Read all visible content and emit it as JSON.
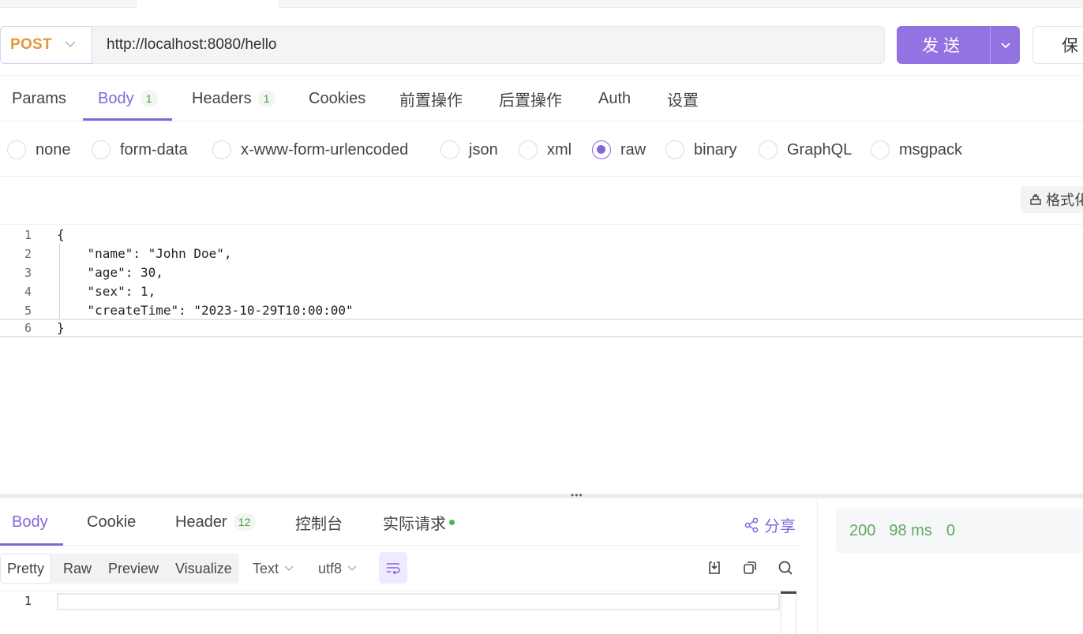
{
  "request": {
    "method": "POST",
    "url": "http://localhost:8080/hello",
    "send_label": "发送",
    "save_label": "保"
  },
  "request_tabs": [
    {
      "label": "Params",
      "badge": ""
    },
    {
      "label": "Body",
      "badge": "1"
    },
    {
      "label": "Headers",
      "badge": "1"
    },
    {
      "label": "Cookies",
      "badge": ""
    },
    {
      "label": "前置操作",
      "badge": ""
    },
    {
      "label": "后置操作",
      "badge": ""
    },
    {
      "label": "Auth",
      "badge": ""
    },
    {
      "label": "设置",
      "badge": ""
    }
  ],
  "body_types": [
    "none",
    "form-data",
    "x-www-form-urlencoded",
    "json",
    "xml",
    "raw",
    "binary",
    "GraphQL",
    "msgpack"
  ],
  "body_type_selected": "raw",
  "format_label": "格式化",
  "editor": {
    "line_numbers": [
      "1",
      "2",
      "3",
      "4",
      "5",
      "6"
    ],
    "lines": [
      "{",
      "    \"name\": \"John Doe\",",
      "    \"age\": 30,",
      "    \"sex\": 1,",
      "    \"createTime\": \"2023-10-29T10:00:00\"",
      "}"
    ]
  },
  "response_tabs": [
    {
      "label": "Body",
      "badge": ""
    },
    {
      "label": "Cookie",
      "badge": ""
    },
    {
      "label": "Header",
      "badge": "12"
    },
    {
      "label": "控制台",
      "badge": ""
    },
    {
      "label": "实际请求",
      "badge": ""
    }
  ],
  "share_label": "分享",
  "view_modes": [
    "Pretty",
    "Raw",
    "Preview",
    "Visualize"
  ],
  "view_mode_selected": "Pretty",
  "format_select": "Text",
  "encoding_select": "utf8",
  "response_editor": {
    "line_numbers": [
      "1"
    ]
  },
  "status": {
    "code": "200",
    "time": "98 ms",
    "size": "0"
  },
  "colors": {
    "accent": "#8466db",
    "send_button": "#9373e2",
    "method": "#e5953b",
    "status_ok": "#5fa75f"
  },
  "icons": {
    "method_dropdown": "chevron-down-icon",
    "send_dropdown": "chevron-down-icon",
    "format": "broom-icon",
    "share": "share-icon",
    "wrap": "wrap-lines-icon",
    "download": "download-icon",
    "copy": "copy-icon",
    "search": "search-icon"
  }
}
